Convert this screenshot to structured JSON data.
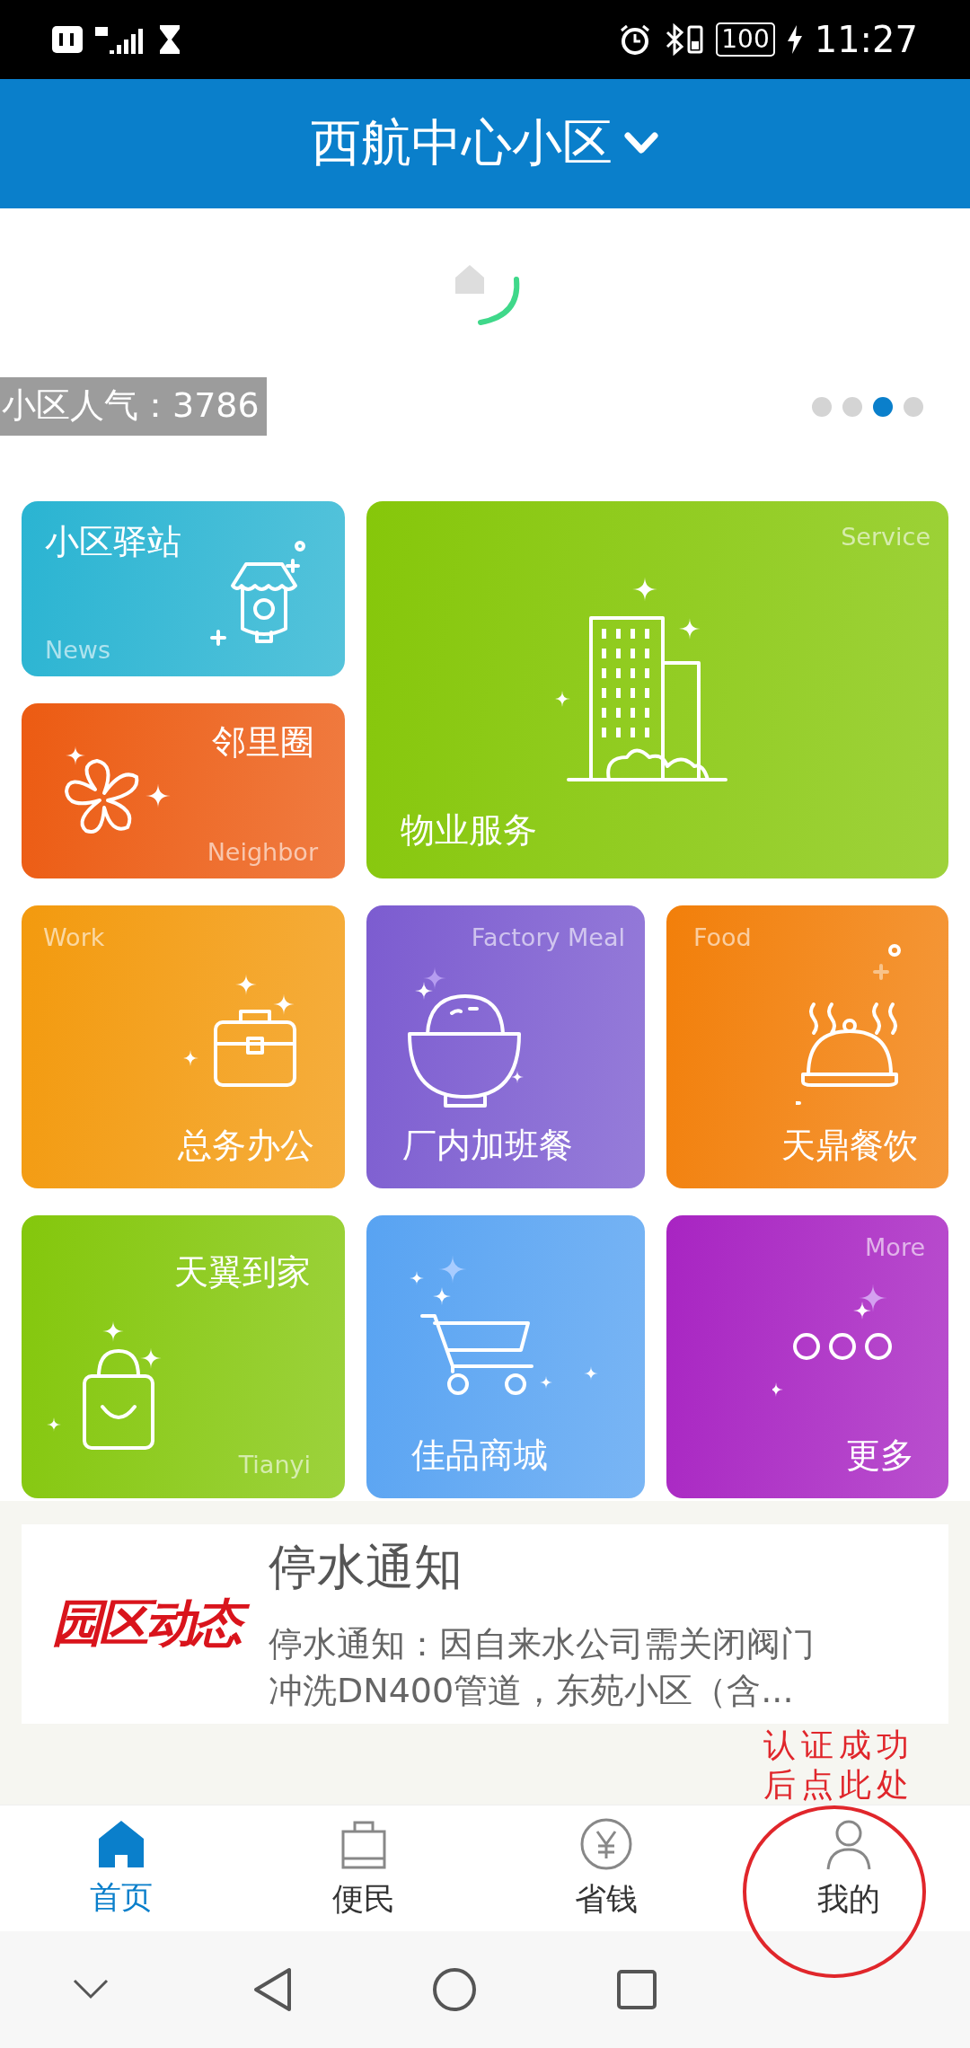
{
  "status_bar": {
    "battery": "100",
    "time": "11:27"
  },
  "header": {
    "title": "西航中心小区"
  },
  "banner": {
    "popularity": "小区人气：3786",
    "dots": [
      {
        "selected": false
      },
      {
        "selected": false
      },
      {
        "selected": true
      },
      {
        "selected": false
      }
    ]
  },
  "tiles": [
    {
      "kind": "wide",
      "title": "小区驿站",
      "subtitle": "News",
      "color": "#2ab4d2"
    },
    {
      "kind": "wide",
      "title": "邻里圈",
      "subtitle": "Neighbor",
      "color": "#ec5b12"
    },
    {
      "kind": "big",
      "title": "物业服务",
      "subtitle": "Service",
      "color": "#86c70a"
    },
    {
      "kind": "square",
      "title": "总务办公",
      "subtitle": "Work",
      "color": "#f39a0e"
    },
    {
      "kind": "square",
      "title": "厂内加班餐",
      "subtitle": "Factory Meal",
      "color": "#7c5cd0"
    },
    {
      "kind": "square",
      "title": "天鼎餐饮",
      "subtitle": "Food",
      "color": "#f27f0a"
    },
    {
      "kind": "square",
      "title": "天翼到家",
      "subtitle": "Tianyi",
      "color": "#84c70c"
    },
    {
      "kind": "square",
      "title": "佳品商城",
      "color": "#58a3f2"
    },
    {
      "kind": "square",
      "title": "更多",
      "subtitle": "More",
      "color": "#a824c2"
    }
  ],
  "news": {
    "logo": "园区动态",
    "title": "停水通知",
    "body": "停水通知：因自来水公司需关闭阀门冲洗DN400管道，东苑小区（含..."
  },
  "tabs": [
    {
      "label": "首页",
      "selected": true
    },
    {
      "label": "便民",
      "selected": false
    },
    {
      "label": "省钱",
      "selected": false
    },
    {
      "label": "我的",
      "selected": false
    }
  ],
  "annotation": {
    "lines": [
      "认证成功",
      "后点此处"
    ]
  }
}
